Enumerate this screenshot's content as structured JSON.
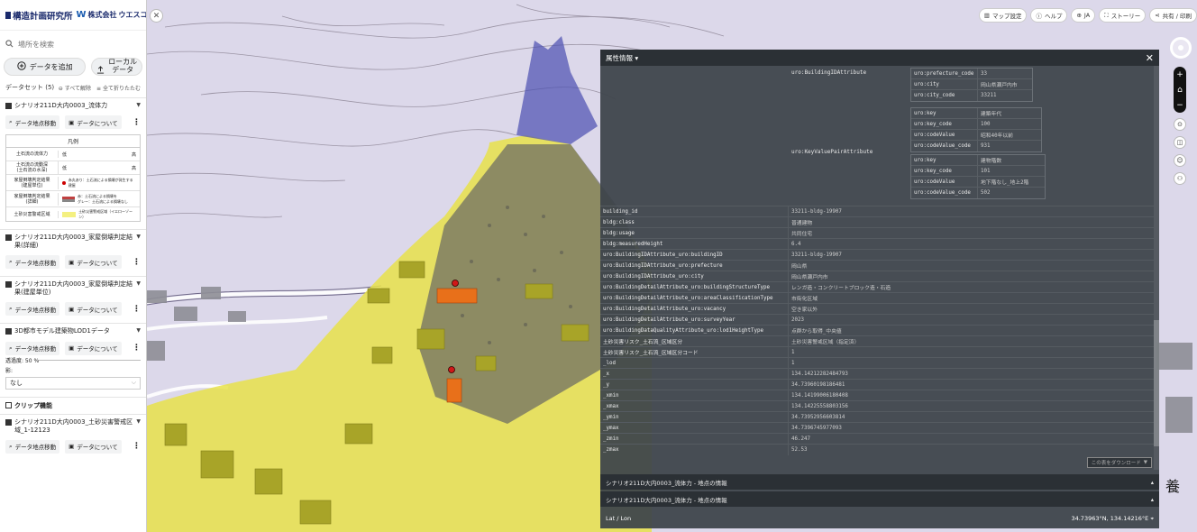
{
  "logos": {
    "company1": "構造計画研究所",
    "company2_small": "株式会社",
    "company2": "ウエスコ"
  },
  "search": {
    "placeholder": "場所を検索"
  },
  "actions": {
    "add_data": "データを追加",
    "local_data": "ローカル\nデータ"
  },
  "dataset": {
    "label": "データセット (5)",
    "clear_all": "すべて解除",
    "collapse_all": "全て折りたたむ"
  },
  "layers": [
    {
      "title": "シナリオ211D大内0003_流体力",
      "btn_move": "データ地点移動",
      "btn_about": "データについて"
    },
    {
      "title": "シナリオ211D大内0003_家屋倒壊判定結果(詳細)",
      "btn_move": "データ地点移動",
      "btn_about": "データについて"
    },
    {
      "title": "シナリオ211D大内0003_家屋倒壊判定結果(建屋単位)",
      "btn_move": "データ地点移動",
      "btn_about": "データについて"
    },
    {
      "title": "3D都市モデル建築物LOD1データ",
      "btn_move": "データ地点移動",
      "btn_about": "データについて",
      "opacity": "透過度: 50 %",
      "shadow_label": "影:",
      "shadow_value": "なし"
    },
    {
      "title": "シナリオ211D大内0003_土砂災害警戒区域_1-12123",
      "btn_move": "データ地点移動",
      "btn_about": "データについて"
    }
  ],
  "clip": {
    "label": "クリップ機能"
  },
  "legend": {
    "title": "凡例",
    "rows": [
      {
        "label": "土石流の流体力",
        "min": "低",
        "max": "高"
      },
      {
        "label": "土石流の流動深\n(土石流の水深)",
        "min": "低",
        "max": "高"
      },
      {
        "label": "家屋倒壊判定結果\n(建屋単位)",
        "text": "赤丸あり：土石流による損壊が発生する建屋"
      },
      {
        "label": "家屋倒壊判定結果\n(詳細)",
        "text": "赤：土石流による損壊を\nグレー：土石流による損壊なし"
      },
      {
        "label": "土砂災害警戒区域",
        "text": "土砂災害警戒区域（イエローゾーン）"
      }
    ]
  },
  "toolbar": {
    "map_settings": "マップ設定",
    "help": "ヘルプ",
    "lang": "JA",
    "story": "ストーリー",
    "share": "共有 / 印刷"
  },
  "info": {
    "title": "属性情報",
    "building_id_attr": "uro:BuildingIDAttribute",
    "key_value_attr": "uro:KeyValuePairAttribute",
    "id_rows": [
      {
        "k": "uro:prefecture_code",
        "v": "33"
      },
      {
        "k": "uro:city",
        "v": "岡山県瀬戸内市"
      },
      {
        "k": "uro:city_code",
        "v": "33211"
      }
    ],
    "kv_rows_1": [
      {
        "k": "uro:key",
        "v": "建築年代"
      },
      {
        "k": "uro:key_code",
        "v": "100"
      },
      {
        "k": "uro:codeValue",
        "v": "昭和40年以前"
      },
      {
        "k": "uro:codeValue_code",
        "v": "931"
      }
    ],
    "kv_rows_2": [
      {
        "k": "uro:key",
        "v": "建物階数"
      },
      {
        "k": "uro:key_code",
        "v": "101"
      },
      {
        "k": "uro:codeValue",
        "v": "地下階なし_地上2階"
      },
      {
        "k": "uro:codeValue_code",
        "v": "502"
      }
    ],
    "props": [
      {
        "k": "building_id",
        "v": "33211-bldg-19907"
      },
      {
        "k": "bldg:class",
        "v": "普通建物"
      },
      {
        "k": "bldg:usage",
        "v": "共同住宅"
      },
      {
        "k": "bldg:measuredHeight",
        "v": "6.4"
      },
      {
        "k": "uro:BuildingIDAttribute_uro:buildingID",
        "v": "33211-bldg-19907"
      },
      {
        "k": "uro:BuildingIDAttribute_uro:prefecture",
        "v": "岡山県"
      },
      {
        "k": "uro:BuildingIDAttribute_uro:city",
        "v": "岡山県瀬戸内市"
      },
      {
        "k": "uro:BuildingDetailAttribute_uro:buildingStructureType",
        "v": "レンガ造・コンクリートブロック造・石造"
      },
      {
        "k": "uro:BuildingDetailAttribute_uro:areaClassificationType",
        "v": "市街化区域"
      },
      {
        "k": "uro:BuildingDetailAttribute_uro:vacancy",
        "v": "空き家以外"
      },
      {
        "k": "uro:BuildingDetailAttribute_uro:surveyYear",
        "v": "2023"
      },
      {
        "k": "uro:BuildingDataQualityAttribute_uro:lod1HeightType",
        "v": "点群から取得_中央値"
      },
      {
        "k": "土砂災害リスク_土石流_区域区分",
        "v": "土砂災害警戒区域（指定済）"
      },
      {
        "k": "土砂災害リスク_土石流_区域区分コード",
        "v": "1"
      },
      {
        "k": "_lod",
        "v": "1"
      },
      {
        "k": "_x",
        "v": "134.14212282484793"
      },
      {
        "k": "_y",
        "v": "34.73960198186481"
      },
      {
        "k": "_xmin",
        "v": "134.14199006180408"
      },
      {
        "k": "_xmax",
        "v": "134.14225558803156"
      },
      {
        "k": "_ymin",
        "v": "34.73952956603814"
      },
      {
        "k": "_ymax",
        "v": "34.7396745977093"
      },
      {
        "k": "_zmin",
        "v": "46.247"
      },
      {
        "k": "_zmax",
        "v": "52.53"
      }
    ],
    "download": "この表をダウンロード",
    "sections": [
      "シナリオ211D大内0003_流体力 - 地点の情報",
      "シナリオ211D大内0003_流体力 - 地点の情報"
    ],
    "latlon_label": "Lat / Lon",
    "latlon_value": "34.73963°N, 134.14216°E"
  },
  "map": {
    "kanji_label": "養"
  }
}
